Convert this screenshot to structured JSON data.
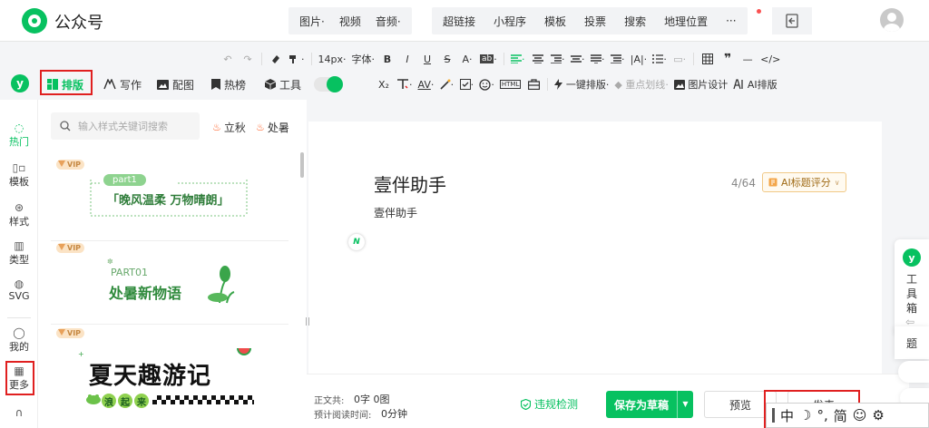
{
  "app": {
    "title": "公众号"
  },
  "header": {
    "media": [
      {
        "label": "图片",
        "dropdown": true
      },
      {
        "label": "视频",
        "dropdown": false
      },
      {
        "label": "音频",
        "dropdown": true
      }
    ],
    "inserts": [
      "超链接",
      "小程序",
      "模板",
      "投票",
      "搜索",
      "地理位置"
    ],
    "more_label": "···"
  },
  "toolbar": {
    "undo": "↶",
    "redo": "↷",
    "font_size": "14px",
    "font_family": "字体",
    "bold": "B",
    "italic": "I",
    "underline": "U",
    "strike": "S",
    "font_color": "A",
    "bg_label": "ab",
    "quote": "❞",
    "hr": "—",
    "code": "</>",
    "subscript": "X₂",
    "av_label": "AV",
    "html_label": "HTML",
    "one_key": "一键排版",
    "key_line": "重点划线",
    "image_design": "图片设计",
    "ai_layout": "AI排版"
  },
  "tabs": [
    {
      "label": "排版",
      "active": true
    },
    {
      "label": "写作",
      "active": false
    },
    {
      "label": "配图",
      "active": false
    },
    {
      "label": "热榜",
      "active": false
    },
    {
      "label": "工具",
      "active": false
    }
  ],
  "leftnav": [
    {
      "label": "热门",
      "icon": "flame-outline-icon",
      "active": true
    },
    {
      "label": "模板",
      "icon": "template-icon",
      "active": false
    },
    {
      "label": "样式",
      "icon": "style-icon",
      "active": false
    },
    {
      "label": "类型",
      "icon": "type-icon",
      "active": false
    },
    {
      "label": "SVG",
      "icon": "svg-icon",
      "active": false
    },
    {
      "label": "我的",
      "icon": "user-icon",
      "active": false
    },
    {
      "label": "更多",
      "icon": "grid-icon",
      "active": false
    }
  ],
  "panel": {
    "search_placeholder": "输入样式关键词搜索",
    "hot_tags": [
      "立秋",
      "处暑"
    ],
    "vip_label": "VIP",
    "cards": [
      {
        "tag": "part1",
        "title": "「晚风温柔 万物晴朗」"
      },
      {
        "tag": "PART01",
        "title": "处暑新物语"
      },
      {
        "title": "夏天趣游记",
        "subtitle": [
          "浪",
          "起",
          "来"
        ]
      }
    ]
  },
  "editor": {
    "title": "壹伴助手",
    "title_count": "4/64",
    "ai_button": "AI标题评分",
    "author": "壹伴助手"
  },
  "footer": {
    "body_label": "正文共:",
    "body_value": "0字 0图",
    "read_label": "预计阅读时间:",
    "read_value": "0分钟",
    "check_label": "违规检测",
    "save_label": "保存为草稿",
    "preview_label": "预览",
    "publish_label": "发表"
  },
  "toolbox": {
    "label": "工具箱",
    "topic_label": "题"
  },
  "ime": {
    "mode": "中",
    "moon": "☽",
    "punct": "°,",
    "simp": "简",
    "emoji": "☺",
    "gear": "⚙"
  },
  "colors": {
    "brand": "#07c160",
    "highlight": "#e02020"
  }
}
